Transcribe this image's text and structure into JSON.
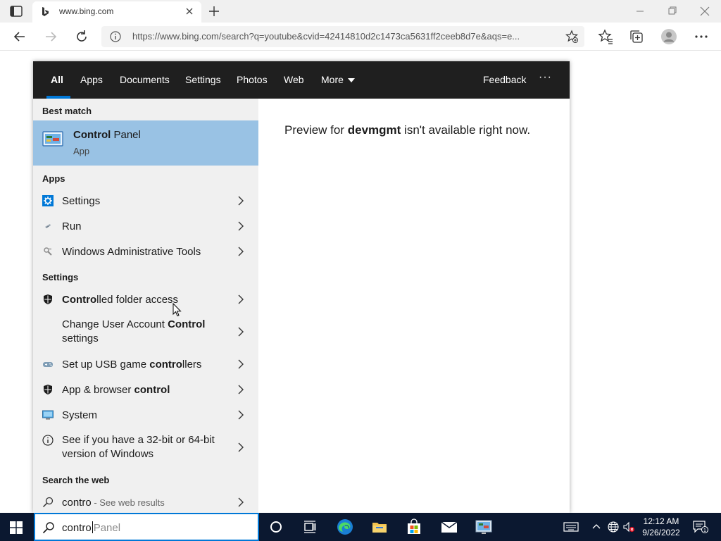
{
  "browser": {
    "tab_title": "www.bing.com",
    "url": "https://www.bing.com/search?q=youtube&cvid=42414810d2c1473ca5631ff2ceeb8d7e&aqs=e..."
  },
  "flyout": {
    "tabs": [
      {
        "label": "All",
        "active": true
      },
      {
        "label": "Apps"
      },
      {
        "label": "Documents"
      },
      {
        "label": "Settings"
      },
      {
        "label": "Photos"
      },
      {
        "label": "Web"
      },
      {
        "label": "More"
      }
    ],
    "feedback_label": "Feedback",
    "more_options": "···",
    "best_match": {
      "section": "Best match",
      "name_bold": "Control",
      "name_rest": " Panel",
      "type": "App"
    },
    "apps": {
      "section": "Apps",
      "items": [
        {
          "label": "Settings",
          "icon": "settings-gear-icon"
        },
        {
          "label": "Run",
          "icon": "run-icon"
        },
        {
          "label": "Windows Administrative Tools",
          "icon": "admin-tools-icon"
        }
      ]
    },
    "settings": {
      "section": "Settings",
      "items": [
        {
          "bold": "Contro",
          "rest": "lled folder access",
          "icon": "shield-icon"
        },
        {
          "pre": "Change User Account ",
          "bold": "Control",
          "rest": " settings",
          "icon": "none"
        },
        {
          "pre": "Set up USB game ",
          "bold": "contro",
          "rest": "llers",
          "icon": "game-controller-icon"
        },
        {
          "pre": "App & browser ",
          "bold": "control",
          "rest": "",
          "icon": "shield-icon"
        },
        {
          "label": "System",
          "icon": "monitor-icon"
        },
        {
          "label": "See if you have a 32-bit or 64-bit version of Windows",
          "icon": "info-icon"
        }
      ]
    },
    "web": {
      "section": "Search the web",
      "query": "contro",
      "hint": " - See web results"
    },
    "preview": {
      "pre": "Preview for ",
      "bold": "devmgmt",
      "post": " isn't available right now."
    }
  },
  "taskbar": {
    "search_typed": "contro",
    "search_suggestion": "Panel",
    "time": "12:12 AM",
    "date": "9/26/2022",
    "notification_count": "1"
  },
  "colors": {
    "flyout_header": "#1f1f1f",
    "best_match_bg": "#99c2e4",
    "accent": "#0078d7",
    "taskbar": "#0b1830"
  }
}
